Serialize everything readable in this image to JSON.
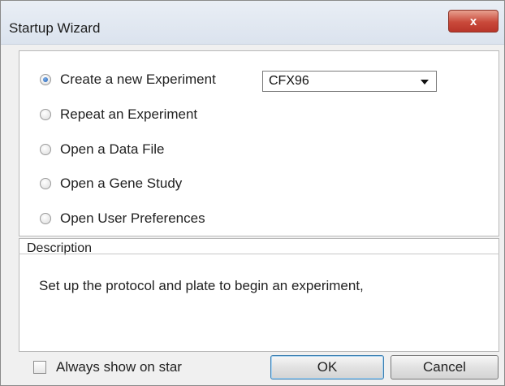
{
  "window": {
    "title": "Startup Wizard",
    "close_label": "x"
  },
  "options": [
    {
      "label": "Create a new Experiment",
      "selected": true
    },
    {
      "label": "Repeat an Experiment",
      "selected": false
    },
    {
      "label": "Open a Data File",
      "selected": false
    },
    {
      "label": "Open a Gene Study",
      "selected": false
    },
    {
      "label": "Open User Preferences",
      "selected": false
    }
  ],
  "instrument_select": {
    "value": "CFX96"
  },
  "description": {
    "heading": "Description",
    "text": "Set up the protocol and plate to begin an experiment,"
  },
  "footer": {
    "always_show_label": "Always show on star",
    "always_show_checked": false,
    "ok_label": "OK",
    "cancel_label": "Cancel"
  }
}
